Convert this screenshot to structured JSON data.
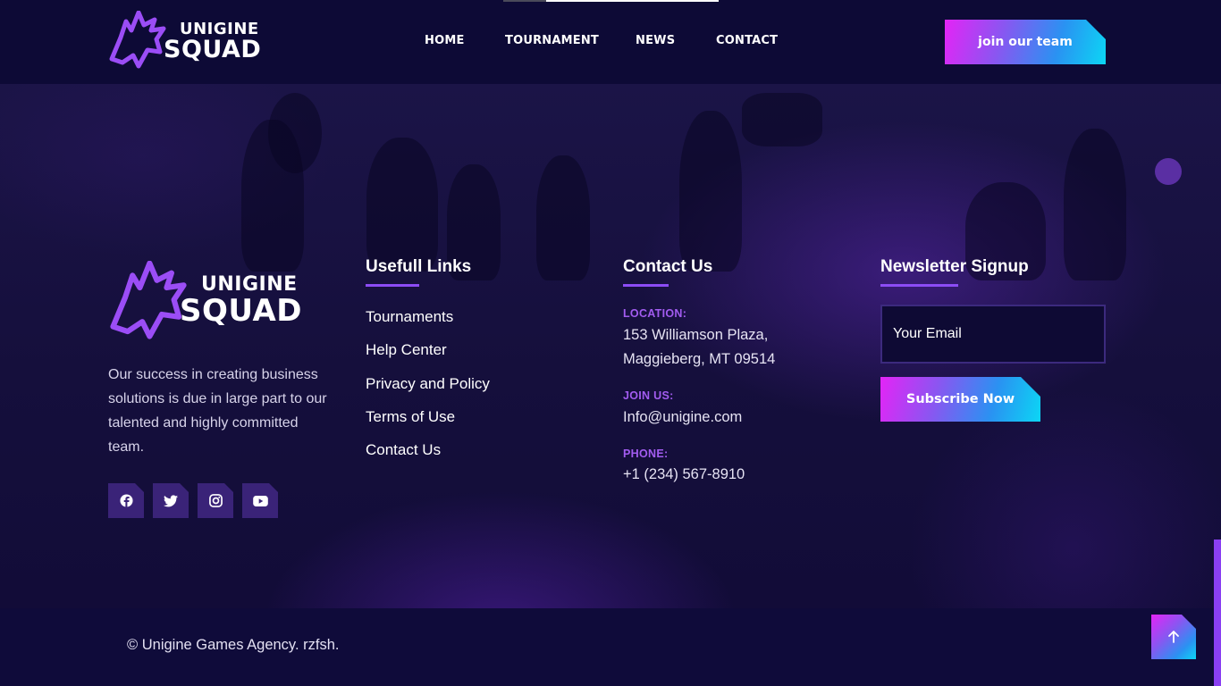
{
  "brand": {
    "line1": "UNIGINE",
    "line2": "SQUAD",
    "accent": "#8c4cf5"
  },
  "nav": {
    "items": [
      "HOME",
      "TOURNAMENT",
      "NEWS",
      "CONTACT"
    ],
    "cta_label": "join our team"
  },
  "footer": {
    "about": {
      "text": "Our success in creating business solutions is due in large part to our talented and highly committed team.",
      "socials": [
        "facebook-icon",
        "twitter-icon",
        "instagram-icon",
        "youtube-icon"
      ]
    },
    "links": {
      "heading": "Usefull Links",
      "items": [
        "Tournaments",
        "Help Center",
        "Privacy and Policy",
        "Terms of Use",
        "Contact Us"
      ]
    },
    "contact": {
      "heading": "Contact Us",
      "location_label": "LOCATION:",
      "location_line1": "153 Williamson Plaza,",
      "location_line2": "Maggieberg, MT 09514",
      "join_label": "JOIN US:",
      "email": "Info@unigine.com",
      "phone_label": "PHONE:",
      "phone": "+1 (234) 567-8910"
    },
    "newsletter": {
      "heading": "Newsletter Signup",
      "email_placeholder": "Your Email",
      "button_label": "Subscribe Now"
    }
  },
  "copyright": "© Unigine Games Agency. rzfsh.",
  "colors": {
    "header_bg": "#0d0a36",
    "label_purple": "#a25cf0",
    "gradient_start": "#e424f6",
    "gradient_end": "#0cd6f4"
  }
}
